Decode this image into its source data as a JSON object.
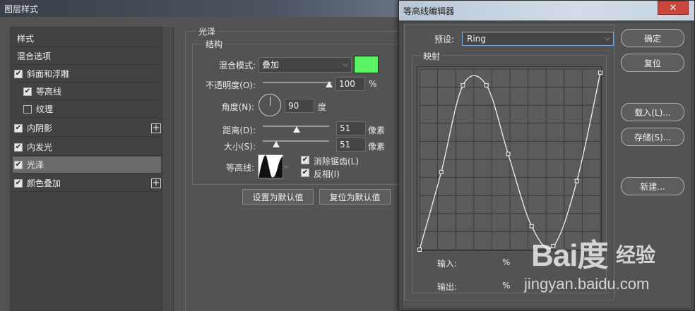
{
  "layer_style": {
    "title": "图层样式",
    "left_panel": {
      "items": [
        {
          "label": "样式",
          "checkbox": null,
          "plus": false,
          "active": false
        },
        {
          "label": "混合选项",
          "checkbox": null,
          "plus": false,
          "active": false
        },
        {
          "label": "斜面和浮雕",
          "checkbox": true,
          "plus": false,
          "active": false
        },
        {
          "label": "等高线",
          "checkbox": true,
          "plus": false,
          "active": false
        },
        {
          "label": "纹理",
          "checkbox": false,
          "plus": false,
          "active": false
        },
        {
          "label": "内阴影",
          "checkbox": true,
          "plus": true,
          "active": false
        },
        {
          "label": "内发光",
          "checkbox": true,
          "plus": false,
          "active": false
        },
        {
          "label": "光泽",
          "checkbox": true,
          "plus": false,
          "active": true
        },
        {
          "label": "颜色叠加",
          "checkbox": true,
          "plus": true,
          "active": false
        }
      ]
    },
    "satin": {
      "section_title": "光泽",
      "structure_title": "结构",
      "blend_mode_label": "混合模式:",
      "blend_mode_value": "叠加",
      "blend_color": "#5cf265",
      "opacity_label": "不透明度(O):",
      "opacity_value": "100",
      "opacity_unit": "%",
      "opacity_level": 1.0,
      "angle_label": "角度(N):",
      "angle_value": "90",
      "angle_unit": "度",
      "distance_label": "距离(D):",
      "distance_value": "51",
      "distance_unit": "像素",
      "distance_level": 0.51,
      "size_label": "大小(S):",
      "size_value": "51",
      "size_unit": "像素",
      "size_level": 0.2,
      "contour_label": "等高线:",
      "antialias_label": "消除锯齿(L)",
      "antialias_checked": true,
      "invert_label": "反相(I)",
      "invert_checked": true,
      "make_default_btn": "设置为默认值",
      "reset_default_btn": "复位为默认值"
    }
  },
  "contour_editor": {
    "title": "等高线编辑器",
    "close_symbol": "✕",
    "preset_label": "预设:",
    "preset_value": "Ring",
    "mapping_title": "映射",
    "input_label": "输入:",
    "input_unit": "%",
    "output_label": "输出:",
    "output_unit": "%",
    "buttons": {
      "ok": "确定",
      "reset": "复位",
      "load": "载入(L)...",
      "save": "存储(S)...",
      "new": "新建..."
    },
    "curve_points": [
      {
        "input": 0,
        "output": 0
      },
      {
        "input": 12,
        "output": 43
      },
      {
        "input": 24,
        "output": 91
      },
      {
        "input": 37,
        "output": 91
      },
      {
        "input": 49,
        "output": 53
      },
      {
        "input": 62,
        "output": 13
      },
      {
        "input": 74,
        "output": 2
      },
      {
        "input": 87,
        "output": 38
      },
      {
        "input": 100,
        "output": 98
      }
    ]
  },
  "watermark": {
    "logo": "Bai度",
    "text": "经验",
    "url": "jingyan.baidu.com"
  }
}
